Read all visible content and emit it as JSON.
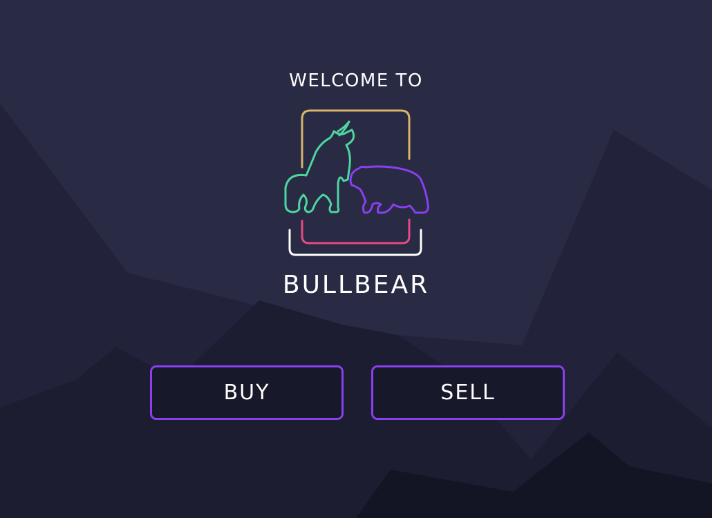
{
  "welcome_text": "WELCOME TO",
  "brand_name": "BULLBEAR",
  "actions": {
    "buy_label": "BUY",
    "sell_label": "SELL"
  },
  "icons": {
    "logo": "bull-and-bear-logo-icon"
  },
  "colors": {
    "background": "#292a44",
    "mountain_dark": "#171829",
    "button_border": "#8a3ff0",
    "bull": "#4dd6a0",
    "bear": "#8a3ff0",
    "frame_top": "#d9b46a",
    "frame_pink": "#e64a86",
    "frame_white": "#ffffff",
    "text": "#ffffff"
  }
}
